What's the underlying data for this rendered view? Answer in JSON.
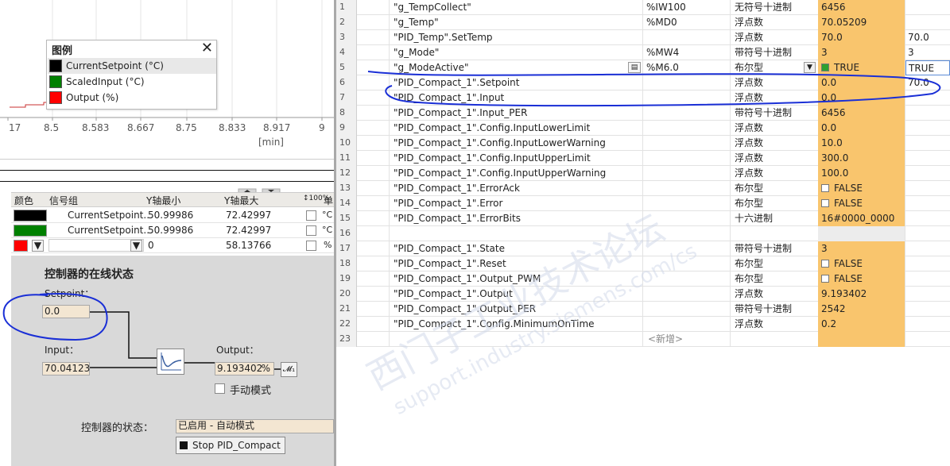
{
  "trend": {
    "x_ticks": [
      "17",
      "8.5",
      "8.583",
      "8.667",
      "8.75",
      "8.833",
      "8.917",
      "9"
    ],
    "x_unit": "[min]",
    "setpoint_color": "#c83232"
  },
  "legend": {
    "title": "图例",
    "items": [
      {
        "label": "CurrentSetpoint (°C)",
        "color": "#000000"
      },
      {
        "label": "ScaledInput (°C)",
        "color": "#008000"
      },
      {
        "label": "Output (%)",
        "color": "#ff0000"
      }
    ]
  },
  "signal_table": {
    "headers": {
      "color": "颜色",
      "group": "信号组",
      "ymin": "Y轴最小",
      "ymax": "Y轴最大",
      "unit": "单"
    },
    "rows": [
      {
        "color": "#000000",
        "name": "CurrentSetpoint..",
        "ymin": "50.99986",
        "ymax": "72.42997",
        "unit": "°C"
      },
      {
        "color": "#008000",
        "name": "CurrentSetpoint..",
        "ymin": "50.99986",
        "ymax": "72.42997",
        "unit": "°C"
      },
      {
        "color": "#ff0000",
        "name": "",
        "ymin": "0",
        "ymax": "58.13766",
        "unit": "%"
      }
    ]
  },
  "controller": {
    "title": "控制器的在线状态",
    "setpoint_label": "Setpoint：",
    "setpoint_value": "0.0",
    "input_label": "Input：",
    "input_value": "70.04123",
    "output_label": "Output：",
    "output_value": "9.193402",
    "output_unit": "%",
    "manual_mode_label": "手动模式",
    "status_label": "控制器的状态：",
    "status_value": "已启用 - 自动模式",
    "stop_button": "Stop PID_Compact"
  },
  "watch_table": {
    "rows": [
      {
        "n": "1",
        "name": "\"g_TempCollect\"",
        "addr": "%IW100",
        "fmt": "无符号十进制",
        "value": "6456",
        "modify": ""
      },
      {
        "n": "2",
        "name": "\"g_Temp\"",
        "addr": "%MD0",
        "fmt": "浮点数",
        "value": "70.05209",
        "modify": ""
      },
      {
        "n": "3",
        "name": "\"PID_Temp\".SetTemp",
        "addr": "",
        "fmt": "浮点数",
        "value": "70.0",
        "modify": "70.0"
      },
      {
        "n": "4",
        "name": "\"g_Mode\"",
        "addr": "%MW4",
        "fmt": "带符号十进制",
        "value": "3",
        "modify": "3"
      },
      {
        "n": "5",
        "name": "\"g_ModeActive\"",
        "addr": "%M6.0",
        "fmt": "布尔型",
        "value": "TRUE",
        "modify": "TRUE",
        "bool": "on",
        "icon": true,
        "dropdown": true
      },
      {
        "n": "6",
        "name": "\"PID_Compact_1\".Setpoint",
        "addr": "",
        "fmt": "浮点数",
        "value": "0.0",
        "modify": "70.0"
      },
      {
        "n": "7",
        "name": "\"PID_Compact_1\".Input",
        "addr": "",
        "fmt": "浮点数",
        "value": "0.0",
        "modify": ""
      },
      {
        "n": "8",
        "name": "\"PID_Compact_1\".Input_PER",
        "addr": "",
        "fmt": "带符号十进制",
        "value": "6456",
        "modify": ""
      },
      {
        "n": "9",
        "name": "\"PID_Compact_1\".Config.InputLowerLimit",
        "addr": "",
        "fmt": "浮点数",
        "value": "0.0",
        "modify": ""
      },
      {
        "n": "10",
        "name": "\"PID_Compact_1\".Config.InputLowerWarning",
        "addr": "",
        "fmt": "浮点数",
        "value": "10.0",
        "modify": ""
      },
      {
        "n": "11",
        "name": "\"PID_Compact_1\".Config.InputUpperLimit",
        "addr": "",
        "fmt": "浮点数",
        "value": "300.0",
        "modify": ""
      },
      {
        "n": "12",
        "name": "\"PID_Compact_1\".Config.InputUpperWarning",
        "addr": "",
        "fmt": "浮点数",
        "value": "100.0",
        "modify": ""
      },
      {
        "n": "13",
        "name": "\"PID_Compact_1\".ErrorAck",
        "addr": "",
        "fmt": "布尔型",
        "value": "FALSE",
        "modify": "",
        "bool": "off"
      },
      {
        "n": "14",
        "name": "\"PID_Compact_1\".Error",
        "addr": "",
        "fmt": "布尔型",
        "value": "FALSE",
        "modify": "",
        "bool": "off"
      },
      {
        "n": "15",
        "name": "\"PID_Compact_1\".ErrorBits",
        "addr": "",
        "fmt": "十六进制",
        "value": "16#0000_0000",
        "modify": ""
      },
      {
        "n": "16",
        "name": "",
        "addr": "",
        "fmt": "",
        "value": "",
        "modify": "",
        "empty": true
      },
      {
        "n": "17",
        "name": "\"PID_Compact_1\".State",
        "addr": "",
        "fmt": "带符号十进制",
        "value": "3",
        "modify": ""
      },
      {
        "n": "18",
        "name": "\"PID_Compact_1\".Reset",
        "addr": "",
        "fmt": "布尔型",
        "value": "FALSE",
        "modify": "",
        "bool": "off"
      },
      {
        "n": "19",
        "name": "\"PID_Compact_1\".Output_PWM",
        "addr": "",
        "fmt": "布尔型",
        "value": "FALSE",
        "modify": "",
        "bool": "off"
      },
      {
        "n": "20",
        "name": "\"PID_Compact_1\".Output",
        "addr": "",
        "fmt": "浮点数",
        "value": "9.193402",
        "modify": ""
      },
      {
        "n": "21",
        "name": "\"PID_Compact_1\".Output_PER",
        "addr": "",
        "fmt": "带符号十进制",
        "value": "2542",
        "modify": ""
      },
      {
        "n": "22",
        "name": "\"PID_Compact_1\".Config.MinimumOnTime",
        "addr": "",
        "fmt": "浮点数",
        "value": "0.2",
        "modify": ""
      },
      {
        "n": "23",
        "name": "",
        "addr": "<新增>",
        "fmt": "",
        "value": "",
        "modify": "",
        "addnew": true
      }
    ]
  }
}
